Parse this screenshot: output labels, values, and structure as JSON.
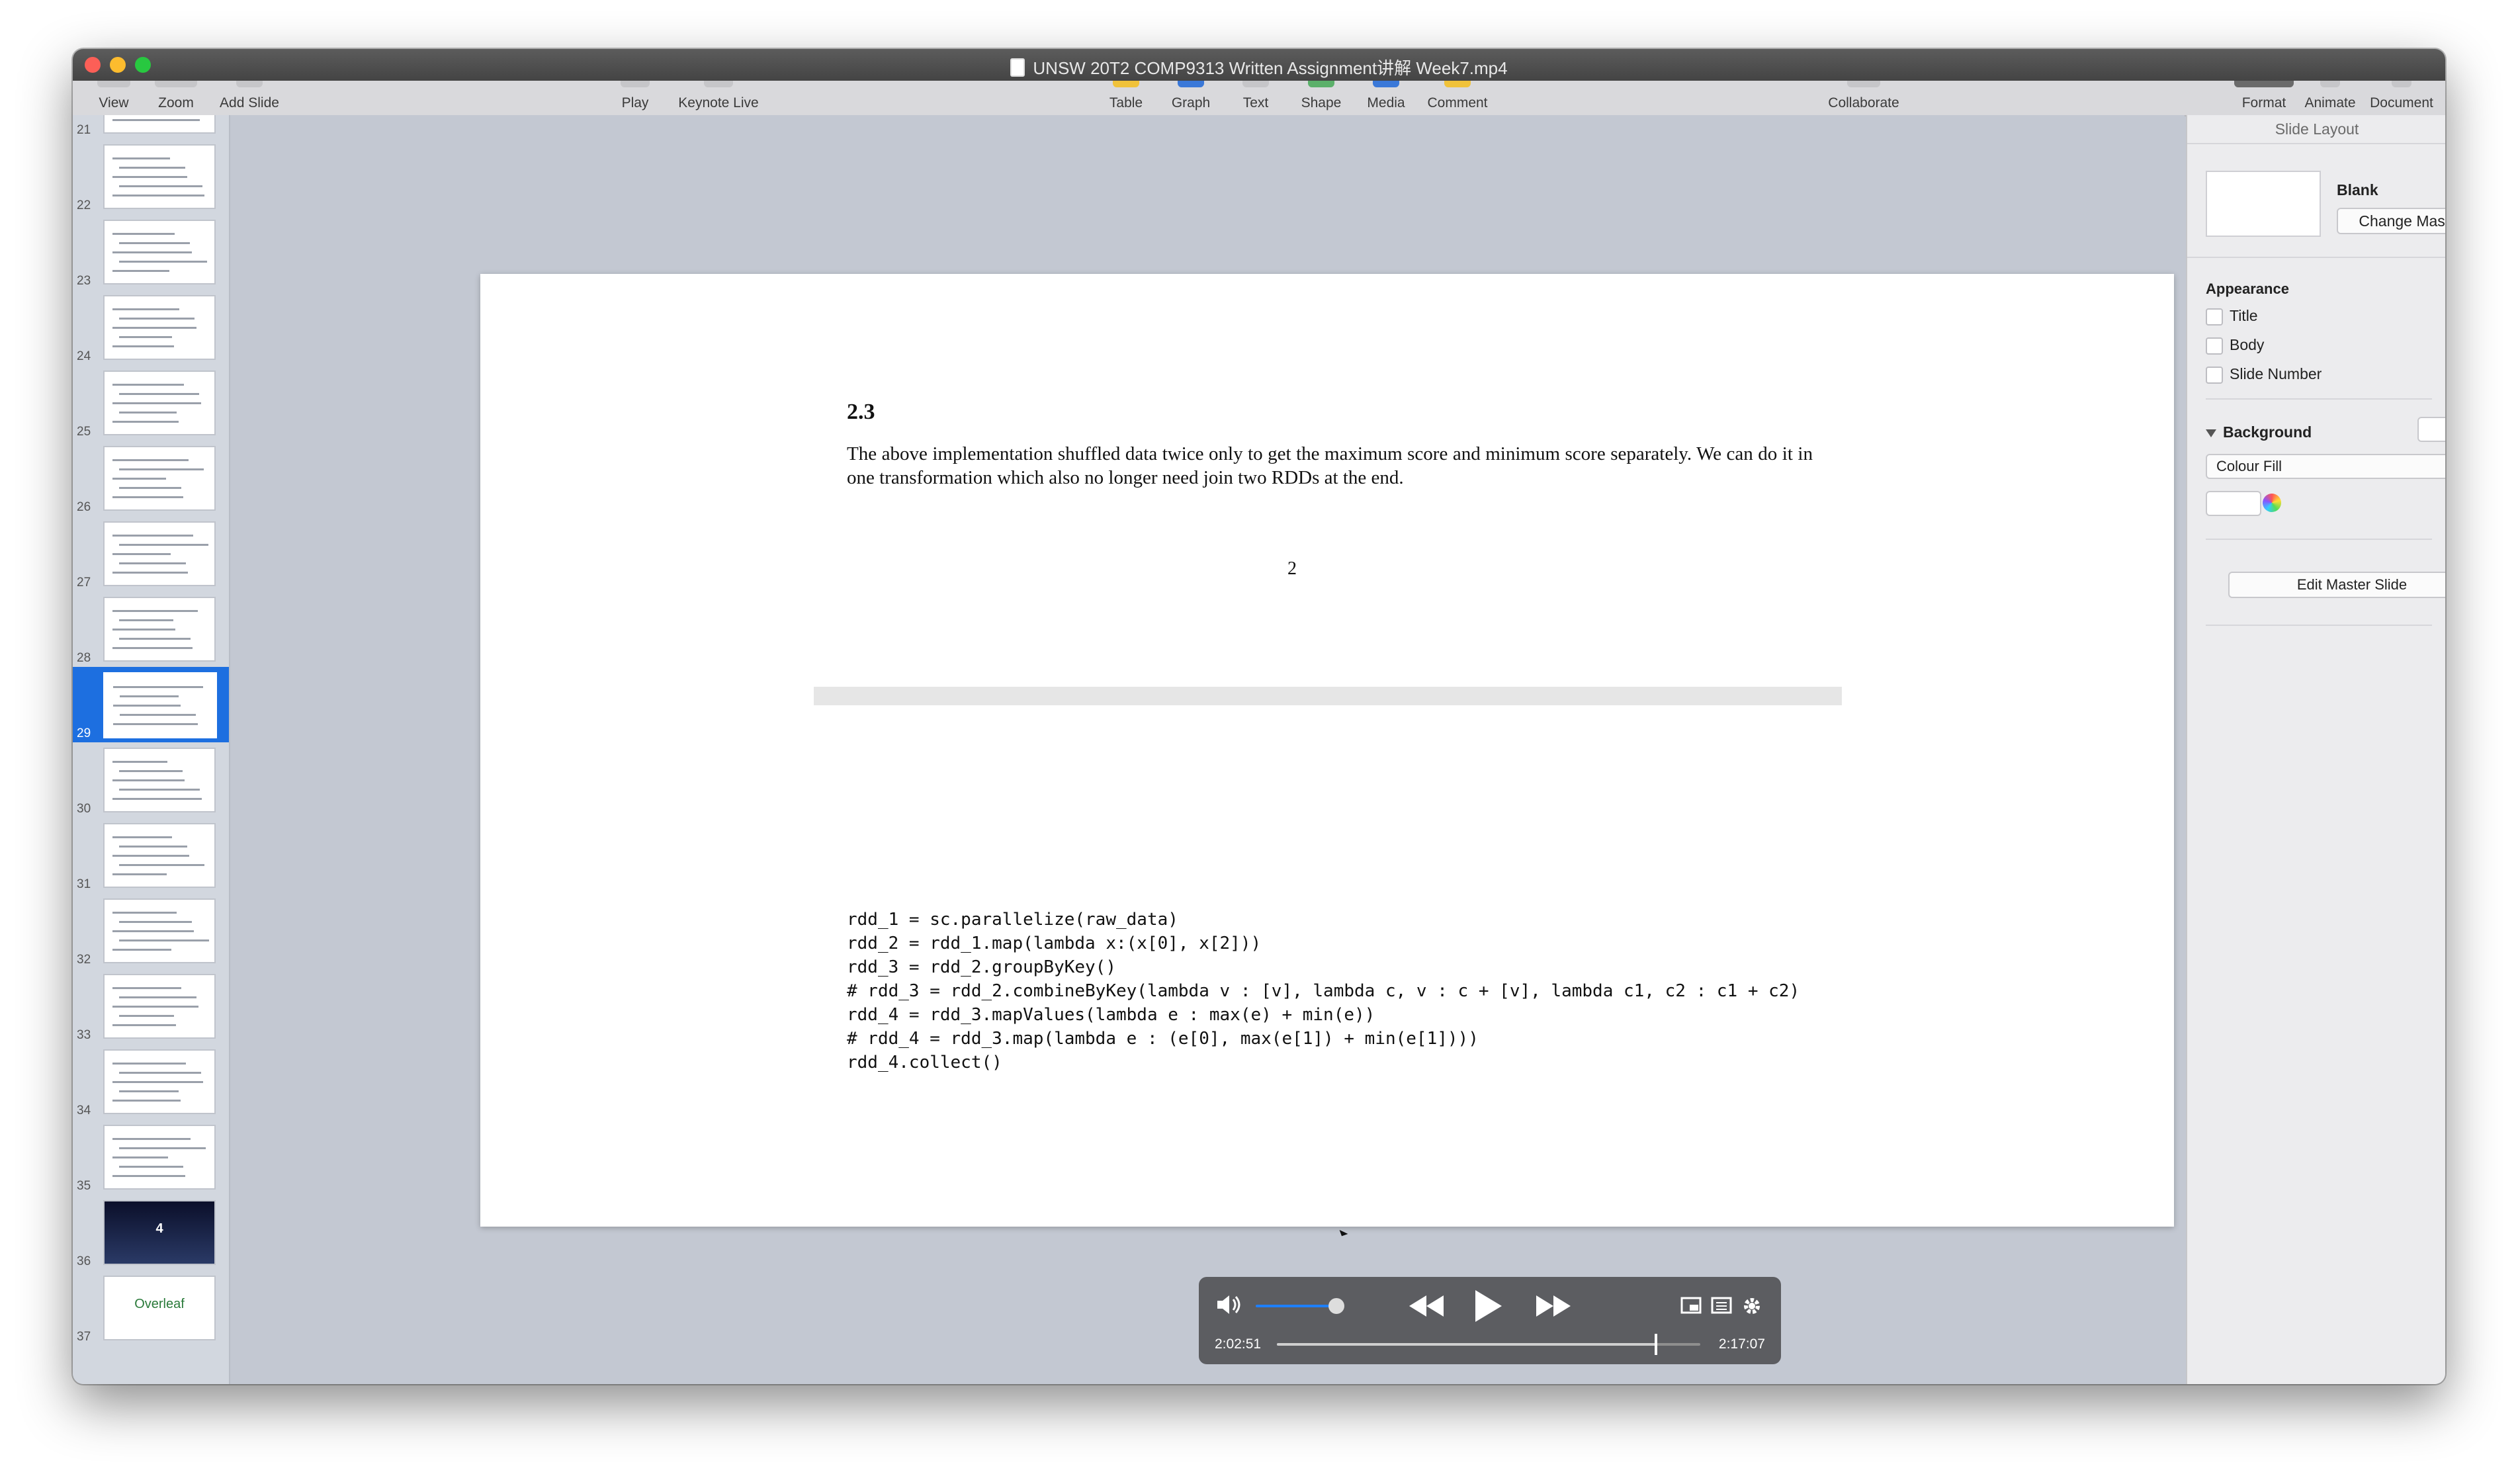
{
  "window": {
    "title": "UNSW 20T2 COMP9313 Written Assignment讲解 Week7.mp4"
  },
  "toolbar": {
    "view": "View",
    "zoom": "Zoom",
    "add_slide": "Add Slide",
    "play": "Play",
    "keynote_live": "Keynote Live",
    "table": "Table",
    "graph": "Graph",
    "text": "Text",
    "shape": "Shape",
    "media": "Media",
    "comment": "Comment",
    "collaborate": "Collaborate",
    "format": "Format",
    "animate": "Animate",
    "document": "Document"
  },
  "navigator": {
    "slides": [
      {
        "num": "21"
      },
      {
        "num": "22"
      },
      {
        "num": "23"
      },
      {
        "num": "24"
      },
      {
        "num": "25"
      },
      {
        "num": "26"
      },
      {
        "num": "27"
      },
      {
        "num": "28"
      },
      {
        "num": "29",
        "selected": true
      },
      {
        "num": "30"
      },
      {
        "num": "31"
      },
      {
        "num": "32"
      },
      {
        "num": "33"
      },
      {
        "num": "34"
      },
      {
        "num": "35"
      },
      {
        "num": "36",
        "thumb_text": "4"
      },
      {
        "num": "37",
        "thumb_text": "Overleaf"
      }
    ]
  },
  "slide": {
    "section": "2.3",
    "paragraph": "The above implementation shuffled data twice only to get the maximum score and minimum score separately. We can do it in one transformation which also no longer need join two RDDs at the end.",
    "page_number": "2",
    "code_lines": [
      "rdd_1 = sc.parallelize(raw_data)",
      "rdd_2 = rdd_1.map(lambda x:(x[0], x[2]))",
      "rdd_3 = rdd_2.groupByKey()",
      "# rdd_3 = rdd_2.combineByKey(lambda v : [v], lambda c, v : c + [v], lambda c1, c2 : c1 + c2)",
      "rdd_4 = rdd_3.mapValues(lambda e : max(e) + min(e))",
      "# rdd_4 = rdd_3.map(lambda e : (e[0], max(e[1]) + min(e[1])))",
      "rdd_4.collect()"
    ]
  },
  "player": {
    "current_time": "2:02:51",
    "total_time": "2:17:07",
    "progress": 0.895,
    "volume": 0.9
  },
  "inspector": {
    "header": "Slide Layout",
    "layout_name": "Blank",
    "change_master": "Change Master",
    "appearance_label": "Appearance",
    "appearance_options": [
      "Title",
      "Body",
      "Slide Number"
    ],
    "background_label": "Background",
    "fill_type": "Colour Fill",
    "edit_master": "Edit Master Slide"
  },
  "colors": {
    "selection": "#1d6fe0",
    "accent": "#1e7fff",
    "close": "#fc5f57",
    "minimize": "#fdbc2e",
    "zoom": "#28c840"
  }
}
